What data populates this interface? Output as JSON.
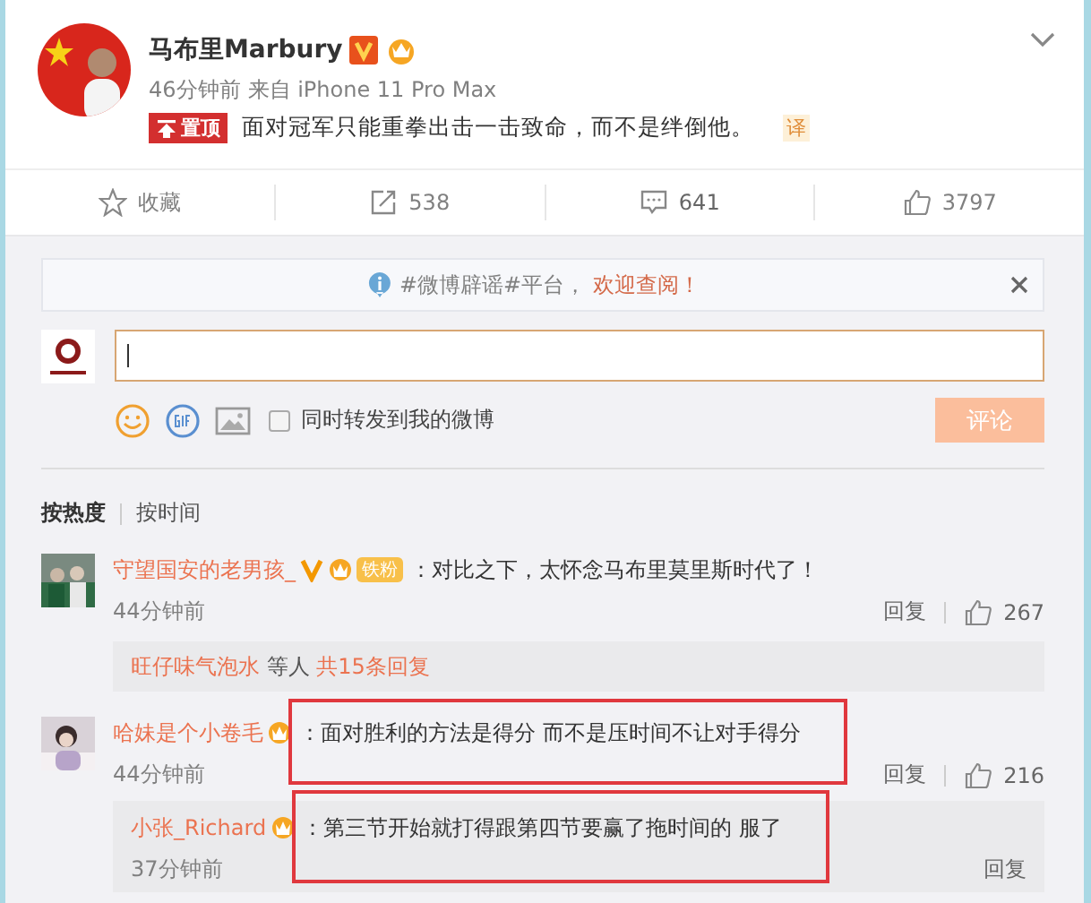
{
  "post": {
    "author": "马布里Marbury",
    "verified": true,
    "time": "46分钟前",
    "source": "来自 iPhone 11 Pro Max",
    "pinned_label": "置顶",
    "text": "面对冠军只能重拳出击一击致命，而不是绊倒他。",
    "translate": "译"
  },
  "actions": [
    {
      "kind": "favorite",
      "label": "收藏",
      "selected": false
    },
    {
      "kind": "repost",
      "label": "538",
      "selected": false
    },
    {
      "kind": "comment",
      "label": "641",
      "selected": true
    },
    {
      "kind": "like",
      "label": "3797",
      "selected": false
    }
  ],
  "notice": {
    "text": "#微博辟谣#平台，",
    "link": "欢迎查阅！"
  },
  "composer": {
    "share_label": "同时转发到我的微博",
    "share_checked": false,
    "submit": "评论"
  },
  "sort_tabs": [
    {
      "label": "按热度",
      "selected": true
    },
    {
      "label": "按时间",
      "selected": false
    }
  ],
  "comments": [
    {
      "author": "守望国安的老男孩_",
      "verified": true,
      "fan_badge": "铁粉",
      "text": "：对比之下，太怀念马布里莫里斯时代了！",
      "time": "44分钟前",
      "reply": "回复",
      "likes": "267",
      "highlighted": false,
      "replies_summary": {
        "first": "旺仔味气泡水",
        "middle": " 等人 ",
        "count": "共15条回复"
      }
    },
    {
      "author": "哈妹是个小卷毛",
      "verified": false,
      "text": "：面对胜利的方法是得分 而不是压时间不让对手得分",
      "time": "44分钟前",
      "reply": "回复",
      "likes": "216",
      "highlighted": true,
      "sub_replies": [
        {
          "author": "小张_Richard",
          "text": "：第三节开始就打得跟第四节要赢了拖时间的 服了",
          "time": "37分钟前",
          "reply": "回复",
          "highlighted": true
        }
      ]
    }
  ]
}
